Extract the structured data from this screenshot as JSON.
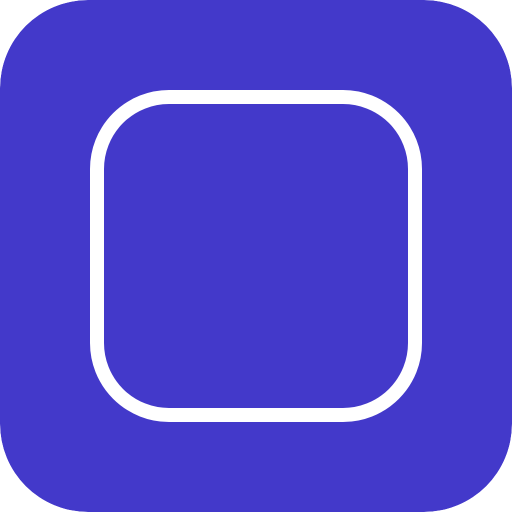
{
  "icon": {
    "name": "rounded-square-outline-icon",
    "background_color": "#4339CA",
    "stroke_color": "#FFFFFF"
  }
}
